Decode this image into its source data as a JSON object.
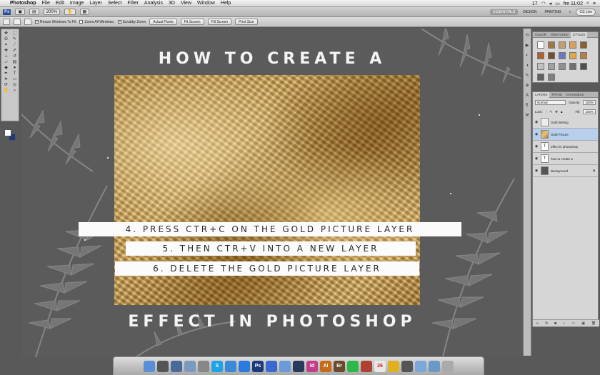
{
  "menubar": {
    "apple": "",
    "app_name": "Photoshop",
    "items": [
      "File",
      "Edit",
      "Image",
      "Layer",
      "Select",
      "Filter",
      "Analysis",
      "3D",
      "View",
      "Window",
      "Help"
    ],
    "right": {
      "badge": "17",
      "day_time": "fre 11:02"
    }
  },
  "appbar": {
    "ps_label": "Ps",
    "zoom": "200%",
    "workspaces": [
      "ESSENTIALS",
      "DESIGN",
      "PAINTING"
    ],
    "more": "»",
    "cs_live": "CS Live"
  },
  "options": {
    "resize_windows": "Resize Windows To Fit",
    "zoom_all": "Zoom All Windows",
    "scrubby": "Scrubby Zoom",
    "actual_pixels": "Actual Pixels",
    "fit_screen": "Fit Screen",
    "fill_screen": "Fill Screen",
    "print_size": "Print Size"
  },
  "canvas": {
    "headline_top": "HOW TO CREATE A",
    "headline_bottom": "EFFECT IN PHOTOSHOP",
    "steps": [
      "4. PRESS CTR+C ON THE GOLD PICTURE LAYER",
      "5. THEN CTR+V INTO A NEW LAYER",
      "6. DELETE THE GOLD PICTURE LAYER"
    ]
  },
  "styles_panel": {
    "tabs": [
      "COLOR",
      "SWATCHES",
      "STYLES"
    ],
    "swatch_colors": [
      "#ffffff",
      "#a07848",
      "#c0a070",
      "#d8a060",
      "#8a6030",
      "#b06028",
      "#705030",
      "#6a7ac0",
      "#e0a848",
      "#b88040",
      "#c0c0c0",
      "#a0a0a0",
      "#909090",
      "#707070",
      "#505050",
      "#606060",
      "#808080"
    ]
  },
  "layers_panel": {
    "tabs": [
      "LAYERS",
      "PATHS",
      "CHANNELS"
    ],
    "blend_mode": "Normal",
    "opacity_label": "Opacity:",
    "opacity_value": "100%",
    "lock_label": "Lock:",
    "fill_label": "Fill:",
    "fill_value": "100%",
    "layers": [
      {
        "name": "Gold Writing",
        "thumb": "",
        "selected": false
      },
      {
        "name": "Gold Picture",
        "thumb": "",
        "selected": true
      },
      {
        "name": "effect in photoshop",
        "thumb": "T",
        "selected": false
      },
      {
        "name": "how to create a",
        "thumb": "T",
        "selected": false
      },
      {
        "name": "Background",
        "thumb": "",
        "selected": false
      }
    ]
  },
  "dock": {
    "apps": [
      {
        "name": "finder",
        "label": "",
        "color": "#5a8ed8"
      },
      {
        "name": "dashboard",
        "label": "",
        "color": "#555"
      },
      {
        "name": "mission-control",
        "label": "",
        "color": "#4a6a9a"
      },
      {
        "name": "photos",
        "label": "",
        "color": "#7a9ac0"
      },
      {
        "name": "migration",
        "label": "",
        "color": "#888"
      },
      {
        "name": "skype",
        "label": "S",
        "color": "#1fa3e8"
      },
      {
        "name": "safari",
        "label": "",
        "color": "#3a8ad8"
      },
      {
        "name": "appstore",
        "label": "",
        "color": "#2a7ae0"
      },
      {
        "name": "photoshop",
        "label": "Ps",
        "color": "#1a3a7a"
      },
      {
        "name": "itunes",
        "label": "",
        "color": "#3a6ad0"
      },
      {
        "name": "mail",
        "label": "",
        "color": "#6a9ad8"
      },
      {
        "name": "lightroom",
        "label": "",
        "color": "#2a3a5a"
      },
      {
        "name": "indesign",
        "label": "Id",
        "color": "#c2408a"
      },
      {
        "name": "illustrator",
        "label": "Ai",
        "color": "#c86a18"
      },
      {
        "name": "bridge",
        "label": "Br",
        "color": "#6a4a2a"
      },
      {
        "name": "spotify",
        "label": "",
        "color": "#2db84a"
      },
      {
        "name": "books",
        "label": "",
        "color": "#b04030"
      },
      {
        "name": "calendar",
        "label": "26",
        "color": "#e8e8e8"
      },
      {
        "name": "chrome",
        "label": "",
        "color": "#e0b020"
      },
      {
        "name": "preview",
        "label": "",
        "color": "#555"
      },
      {
        "name": "folder",
        "label": "",
        "color": "#7aa8d8"
      },
      {
        "name": "downloads",
        "label": "",
        "color": "#6a98c8"
      },
      {
        "name": "trash",
        "label": "",
        "color": "#aaa"
      }
    ]
  }
}
